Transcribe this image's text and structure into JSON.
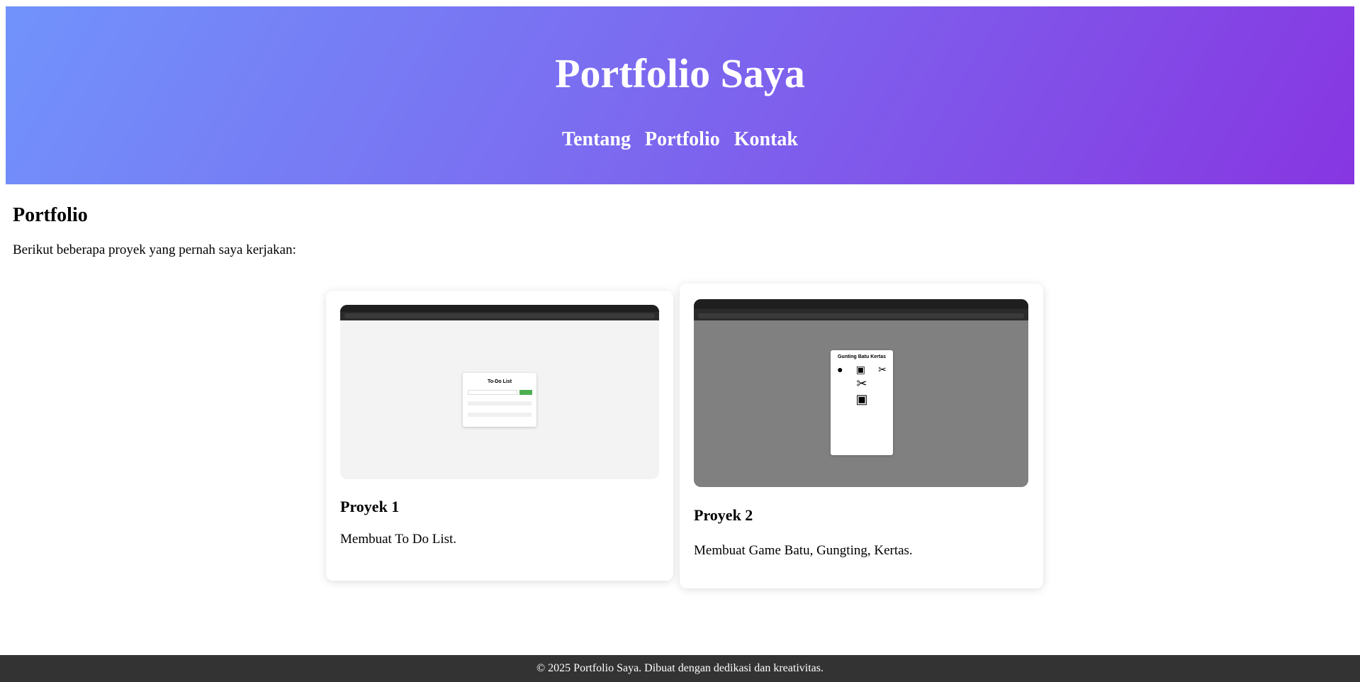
{
  "header": {
    "title": "Portfolio Saya",
    "nav": [
      "Tentang",
      "Portfolio",
      "Kontak"
    ]
  },
  "section": {
    "heading": "Portfolio",
    "intro": "Berikut beberapa proyek yang pernah saya kerjakan:"
  },
  "projects": [
    {
      "title": "Proyek 1",
      "description": "Membuat To Do List.",
      "screenshot": {
        "app_title": "To-Do List"
      }
    },
    {
      "title": "Proyek 2",
      "description": "Membuat Game Batu, Gungting, Kertas.",
      "screenshot": {
        "app_title": "Gunting Batu Kertas"
      }
    }
  ],
  "footer": {
    "text": "© 2025 Portfolio Saya. Dibuat dengan dedikasi dan kreativitas."
  },
  "colors": {
    "header_gradient_start": "#7193fb",
    "header_gradient_end": "#8736e1",
    "footer_bg": "#333333"
  }
}
